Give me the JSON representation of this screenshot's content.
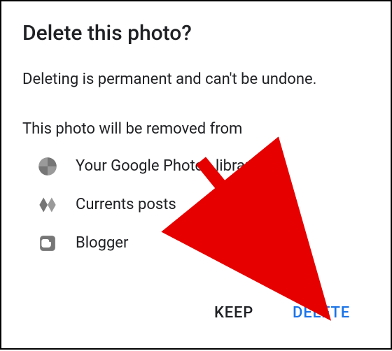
{
  "dialog": {
    "title": "Delete this photo?",
    "warning": "Deleting is permanent and can't be undone.",
    "removed_from": "This photo will be removed from",
    "services": [
      {
        "label": "Your Google Photos library"
      },
      {
        "label": "Currents posts"
      },
      {
        "label": "Blogger"
      }
    ],
    "buttons": {
      "keep": "KEEP",
      "delete": "DELETE"
    }
  },
  "colors": {
    "icon_gray": "#767676",
    "accent_blue": "#1a73e8",
    "annotation_red": "#e60000"
  }
}
